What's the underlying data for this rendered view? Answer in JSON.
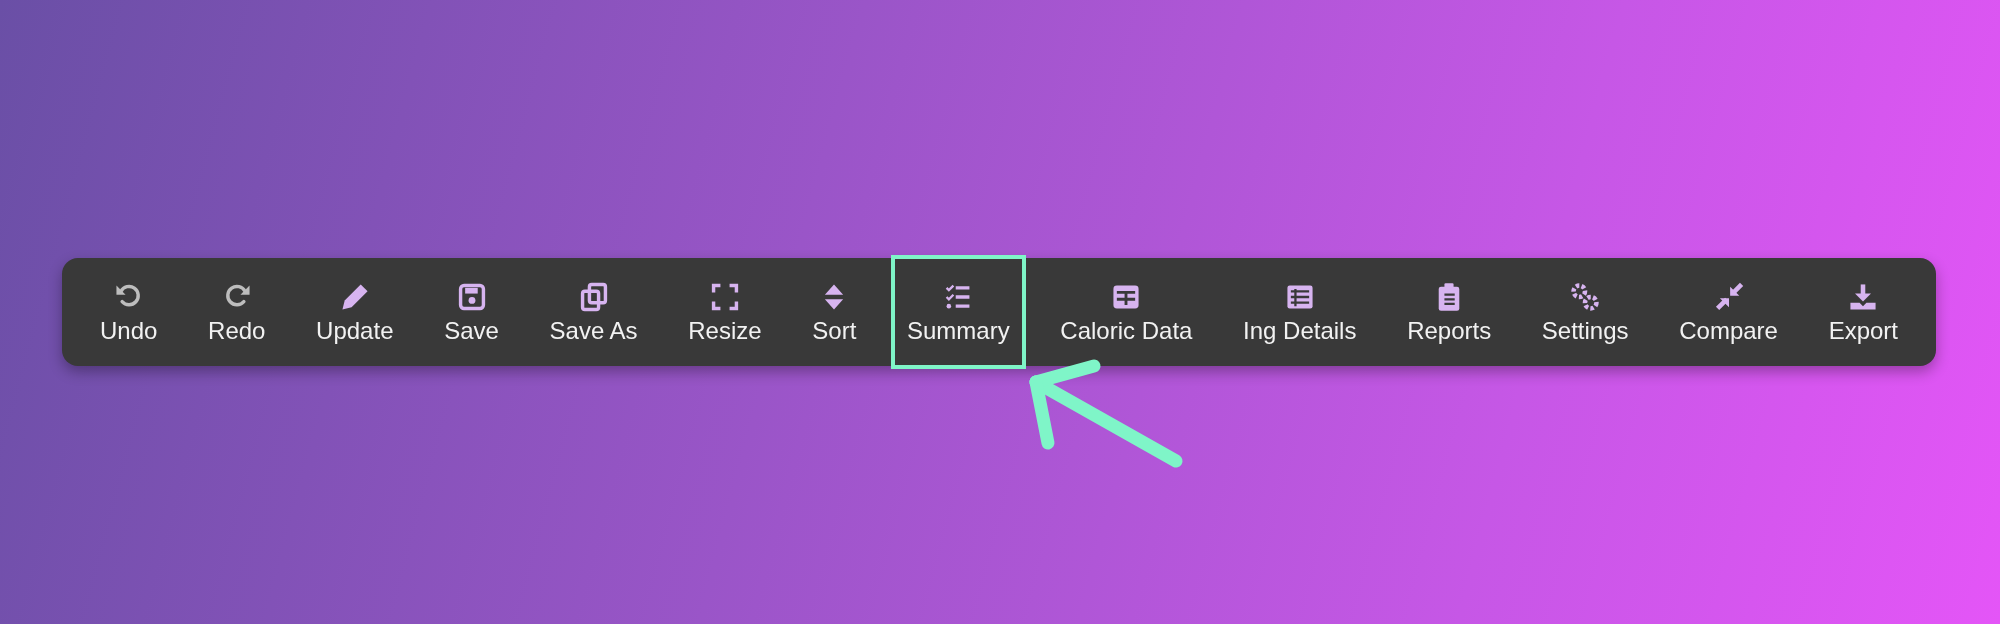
{
  "toolbar": {
    "items": [
      {
        "label": "Undo",
        "disabled": true,
        "highlighted": false
      },
      {
        "label": "Redo",
        "disabled": true,
        "highlighted": false
      },
      {
        "label": "Update",
        "disabled": false,
        "highlighted": false
      },
      {
        "label": "Save",
        "disabled": false,
        "highlighted": false
      },
      {
        "label": "Save As",
        "disabled": false,
        "highlighted": false
      },
      {
        "label": "Resize",
        "disabled": false,
        "highlighted": false
      },
      {
        "label": "Sort",
        "disabled": false,
        "highlighted": false
      },
      {
        "label": "Summary",
        "disabled": false,
        "highlighted": true
      },
      {
        "label": "Caloric Data",
        "disabled": false,
        "highlighted": false
      },
      {
        "label": "Ing Details",
        "disabled": false,
        "highlighted": false
      },
      {
        "label": "Reports",
        "disabled": false,
        "highlighted": false
      },
      {
        "label": "Settings",
        "disabled": false,
        "highlighted": false
      },
      {
        "label": "Compare",
        "disabled": false,
        "highlighted": false
      },
      {
        "label": "Export",
        "disabled": false,
        "highlighted": false
      }
    ]
  }
}
